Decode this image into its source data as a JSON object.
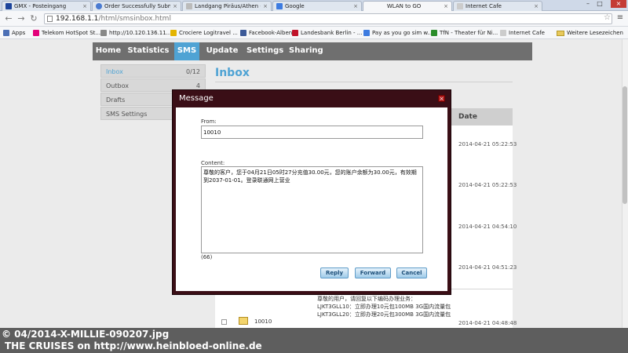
{
  "browser": {
    "tabs": [
      {
        "title": "GMX - Posteingang",
        "favicon_color": "#1c449b"
      },
      {
        "title": "Order Successfully Submi",
        "favicon_color": "#4a7bd1"
      },
      {
        "title": "Landgang Piräus/Athen -",
        "favicon_color": "#bbbbbb"
      },
      {
        "title": "Google",
        "favicon_color": "#3d7be0"
      },
      {
        "title": "WLAN to GO",
        "favicon_color": "#dddddd"
      },
      {
        "title": "Internet Cafe",
        "favicon_color": "#cccccc"
      }
    ],
    "url_host": "192.168.1.1",
    "url_path": "/html/smsinbox.html",
    "bookmarks": [
      {
        "label": "Apps",
        "color": "#4b6fb5"
      },
      {
        "label": "Telekom HotSpot St...",
        "color": "#e3007a"
      },
      {
        "label": "http://10.120.136.11...",
        "color": "#888888"
      },
      {
        "label": "Crociere Logitravel ...",
        "color": "#e3b400"
      },
      {
        "label": "Facebook-Alben",
        "color": "#3b5998"
      },
      {
        "label": "Landesbank Berlin - ...",
        "color": "#c0122a"
      },
      {
        "label": "Pay as you go sim w...",
        "color": "#3d7be0"
      },
      {
        "label": "TfN - Theater für Ni...",
        "color": "#2a8d2a"
      },
      {
        "label": "Internet Cafe",
        "color": "#cccccc"
      }
    ],
    "other_bookmarks": "Weitere Lesezeichen"
  },
  "nav": {
    "items": [
      "Home",
      "Statistics",
      "SMS",
      "Update",
      "Settings",
      "Sharing"
    ],
    "active": "SMS"
  },
  "sidebar": {
    "items": [
      {
        "label": "Inbox",
        "count": "0/12"
      },
      {
        "label": "Outbox",
        "count": "4"
      },
      {
        "label": "Drafts",
        "count": ""
      },
      {
        "label": "SMS Settings",
        "count": ""
      }
    ]
  },
  "inbox": {
    "title": "Inbox",
    "date_header": "Date",
    "dates": [
      "2014-04-21 05:22:53",
      "2014-04-21 05:22:53",
      "2014-04-21 04:54:10",
      "2014-04-21 04:51:23"
    ],
    "row": {
      "from": "10010",
      "content": "尊敬的用户，请回复以下编码办理业务：\nLJKT3GLL10：立即办理10元包100MB 3G国内流量包\nLJKT3GLL20：立即办理20元包300MB 3G国内流量包",
      "date": "2014-04-21 04:48:48"
    }
  },
  "modal": {
    "title": "Message",
    "from_label": "From:",
    "from_value": "10010",
    "content_label": "Content:",
    "content_value": "尊敬的客户，您于04月21日05时27分充值30.00元，您的账户余额为30.00元，有效期到2037-01-01。登录联通网上营业",
    "char_count": "(66)",
    "reply_label": "Reply",
    "forward_label": "Forward",
    "cancel_label": "Cancel"
  },
  "watermark": {
    "line1": "© 04/2014-X-MILLIE-090207.jpg",
    "line2": "THE CRUISES on http://www.heinbloed-online.de"
  }
}
